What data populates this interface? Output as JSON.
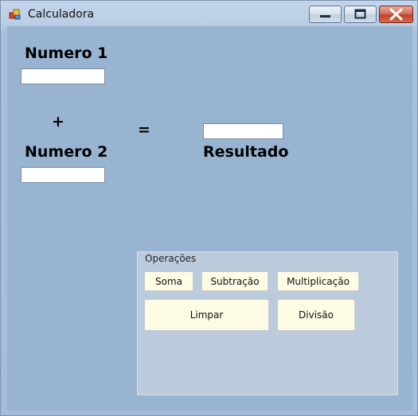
{
  "window": {
    "title": "Calculadora",
    "icon": "app-icon",
    "controls": {
      "minimize": "minimize-icon",
      "maximize": "maximize-icon",
      "close": "close-icon"
    }
  },
  "form": {
    "numero1_label": "Numero 1",
    "numero1_value": "",
    "plus_sign": "+",
    "numero2_label": "Numero 2",
    "numero2_value": "",
    "equals_sign": "=",
    "resultado_value": "",
    "resultado_label": "Resultado"
  },
  "operacoes": {
    "legend": "Operações",
    "buttons": {
      "soma": "Soma",
      "subtracao": "Subtração",
      "multiplicacao": "Multiplicação",
      "limpar": "Limpar",
      "divisao": "Divisão"
    }
  },
  "colors": {
    "form_background": "#99b4d1",
    "button_background": "#fdfbe4",
    "close_button": "#c0412a"
  }
}
